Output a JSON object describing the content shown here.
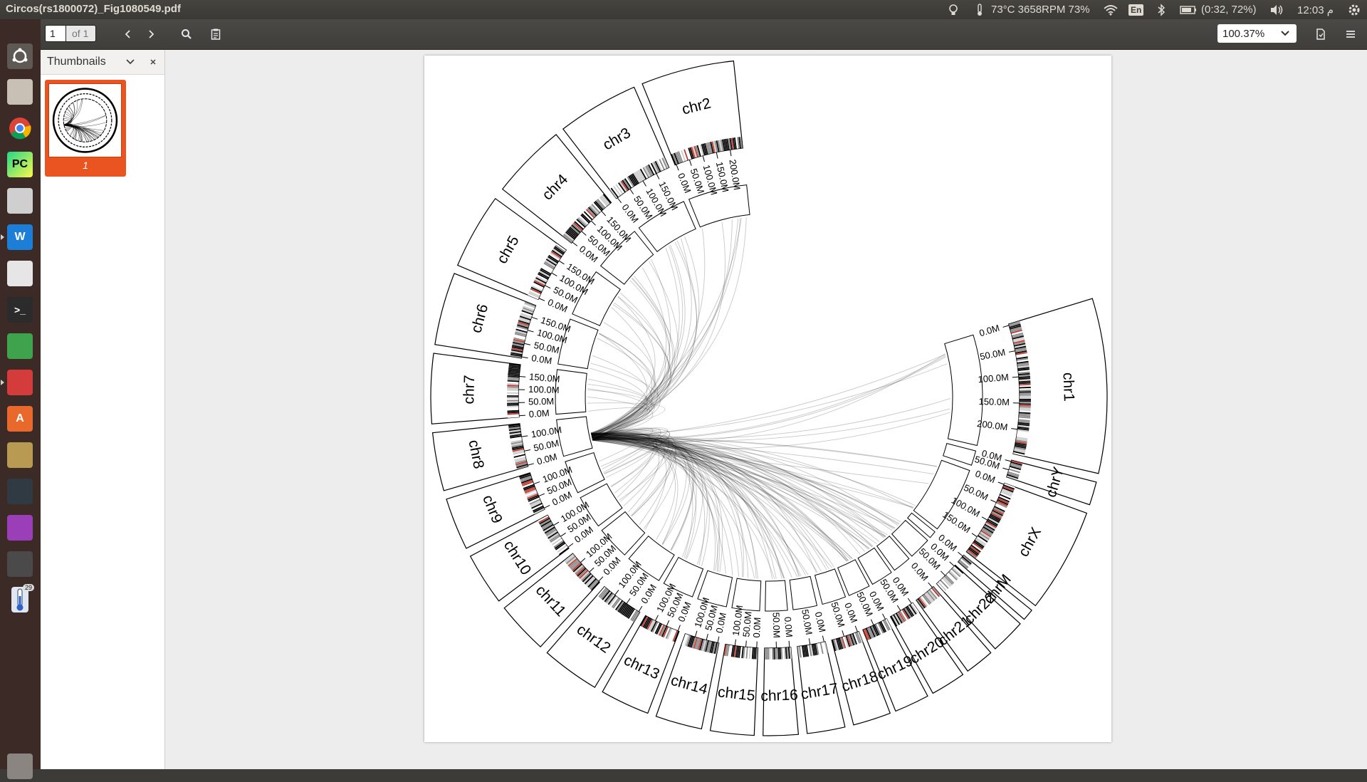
{
  "window": {
    "title": "Circos(rs1800072)_Fig1080549.pdf"
  },
  "tray": {
    "system_status": "73°C 3658RPM 73%",
    "keyboard_layout": "En",
    "battery": "(0:32, 72%)",
    "clock": "م 12:03"
  },
  "launcher": {
    "items": [
      {
        "icon": "ubuntu-dash-icon",
        "color": "#5f5953"
      },
      {
        "icon": "file-manager-icon",
        "color": "#c8c0b5"
      },
      {
        "icon": "chrome-icon",
        "color": "#3d3d3d"
      },
      {
        "icon": "pycharm-icon",
        "color": "#1f9a3c"
      },
      {
        "icon": "text-editor-icon",
        "color": "#cfcfcf"
      },
      {
        "icon": "wps-writer-icon",
        "color": "#1c7ed6"
      },
      {
        "icon": "document-viewer-icon",
        "color": "#e6e6e6"
      },
      {
        "icon": "terminal-icon",
        "color": "#2b2b2b"
      },
      {
        "icon": "spreadsheet-icon",
        "color": "#3fa34d"
      },
      {
        "icon": "pdf-reader-icon",
        "color": "#d43b3b"
      },
      {
        "icon": "software-center-icon",
        "color": "#e9692c"
      },
      {
        "icon": "archive-manager-icon",
        "color": "#b99a52"
      },
      {
        "icon": "system-monitor-icon",
        "color": "#2f3a43"
      },
      {
        "icon": "workspace-icon",
        "color": "#9b3fb8"
      },
      {
        "icon": "window-icon",
        "color": "#4a4a4a"
      },
      {
        "icon": "thermometer-icon",
        "color": "#e0e6f2"
      },
      {
        "icon": "trash-icon",
        "color": "#8a8580"
      }
    ],
    "badge": "29"
  },
  "toolbar": {
    "page_number": "1",
    "page_of": "of 1",
    "zoom": "100.37%"
  },
  "sidebar": {
    "title": "Thumbnails",
    "thumbnails": [
      {
        "label": "1"
      }
    ]
  },
  "chart_data": {
    "type": "chord",
    "chromosomes": [
      {
        "name": "chr1",
        "ticks": [
          "0.0M",
          "50.0M",
          "100.0M",
          "150.0M",
          "200.0M"
        ]
      },
      {
        "name": "chrY",
        "ticks": [
          "0.0M",
          "50.0M"
        ]
      },
      {
        "name": "chrX",
        "ticks": [
          "0.0M",
          "50.0M",
          "100.0M",
          "150.0M"
        ]
      },
      {
        "name": "chrM",
        "ticks": [
          "0.0M"
        ]
      },
      {
        "name": "chr22",
        "ticks": [
          "0.0M",
          "50.0M"
        ]
      },
      {
        "name": "chr21",
        "ticks": [
          "0.0M"
        ]
      },
      {
        "name": "chr20",
        "ticks": [
          "0.0M",
          "50.0M"
        ]
      },
      {
        "name": "chr19",
        "ticks": [
          "0.0M",
          "50.0M"
        ]
      },
      {
        "name": "chr18",
        "ticks": [
          "0.0M",
          "50.0M"
        ]
      },
      {
        "name": "chr17",
        "ticks": [
          "0.0M",
          "50.0M"
        ]
      },
      {
        "name": "chr16",
        "ticks": [
          "0.0M",
          "50.0M"
        ]
      },
      {
        "name": "chr15",
        "ticks": [
          "0.0M",
          "50.0M",
          "100.0M"
        ]
      },
      {
        "name": "chr14",
        "ticks": [
          "0.0M",
          "50.0M",
          "100.0M"
        ]
      },
      {
        "name": "chr13",
        "ticks": [
          "0.0M",
          "50.0M",
          "100.0M"
        ]
      },
      {
        "name": "chr12",
        "ticks": [
          "0.0M",
          "50.0M",
          "100.0M"
        ]
      },
      {
        "name": "chr11",
        "ticks": [
          "0.0M",
          "50.0M",
          "100.0M"
        ]
      },
      {
        "name": "chr10",
        "ticks": [
          "0.0M",
          "50.0M",
          "100.0M"
        ]
      },
      {
        "name": "chr9",
        "ticks": [
          "0.0M",
          "50.0M",
          "100.0M"
        ]
      },
      {
        "name": "chr8",
        "ticks": [
          "0.0M",
          "50.0M",
          "100.0M"
        ]
      },
      {
        "name": "chr7",
        "ticks": [
          "0.0M",
          "50.0M",
          "100.0M",
          "150.0M"
        ]
      },
      {
        "name": "chr6",
        "ticks": [
          "0.0M",
          "50.0M",
          "100.0M",
          "150.0M"
        ]
      },
      {
        "name": "chr5",
        "ticks": [
          "0.0M",
          "50.0M",
          "100.0M",
          "150.0M"
        ]
      },
      {
        "name": "chr4",
        "ticks": [
          "0.0M",
          "50.0M",
          "100.0M",
          "150.0M"
        ]
      },
      {
        "name": "chr3",
        "ticks": [
          "0.0M",
          "50.0M",
          "100.0M",
          "150.0M"
        ]
      },
      {
        "name": "chr2",
        "ticks": [
          "0.0M",
          "50.0M",
          "100.0M",
          "150.0M",
          "200.0M"
        ]
      }
    ],
    "link_hub_chromosome": "chr8",
    "link_count": 160
  }
}
